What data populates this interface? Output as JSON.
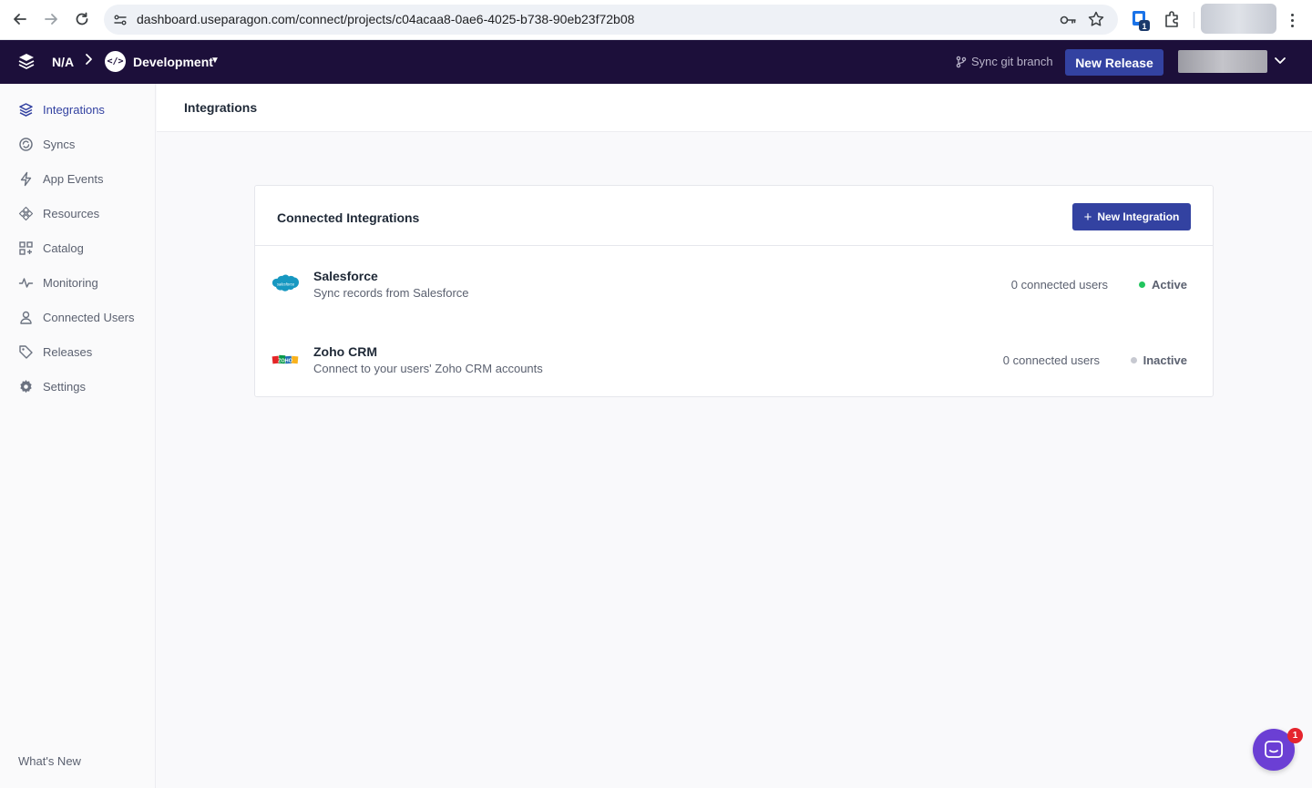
{
  "browser": {
    "url": "dashboard.useparagon.com/connect/projects/c04acaa8-0ae6-4025-b738-90eb23f72b08",
    "extension_badge": "1"
  },
  "app_bar": {
    "project": "N/A",
    "environment": "Development",
    "sync_git_label": "Sync git branch",
    "new_release_label": "New Release"
  },
  "sidebar": {
    "items": [
      {
        "label": "Integrations",
        "icon": "layers-icon",
        "active": true
      },
      {
        "label": "Syncs",
        "icon": "sync-icon",
        "active": false
      },
      {
        "label": "App Events",
        "icon": "bolt-icon",
        "active": false
      },
      {
        "label": "Resources",
        "icon": "resources-icon",
        "active": false
      },
      {
        "label": "Catalog",
        "icon": "catalog-icon",
        "active": false
      },
      {
        "label": "Monitoring",
        "icon": "pulse-icon",
        "active": false
      },
      {
        "label": "Connected Users",
        "icon": "user-icon",
        "active": false
      },
      {
        "label": "Releases",
        "icon": "tag-icon",
        "active": false
      },
      {
        "label": "Settings",
        "icon": "gear-icon",
        "active": false
      }
    ],
    "whats_new": "What's New"
  },
  "page": {
    "title": "Integrations"
  },
  "card": {
    "title": "Connected Integrations",
    "new_integration_label": "New Integration",
    "integrations": [
      {
        "name": "Salesforce",
        "description": "Sync records from Salesforce",
        "users": "0 connected users",
        "status": "Active",
        "status_color": "#22c55e",
        "logo_text": "salesforce"
      },
      {
        "name": "Zoho CRM",
        "description": "Connect to your users' Zoho CRM accounts",
        "users": "0 connected users",
        "status": "Inactive",
        "status_color": "#c7c9d1",
        "logo_text": "ZOHO"
      }
    ]
  },
  "chat": {
    "badge": "1"
  },
  "colors": {
    "app_bar_bg": "#1c0f3a",
    "accent": "#3342a1",
    "chat": "#6b3fd4"
  }
}
